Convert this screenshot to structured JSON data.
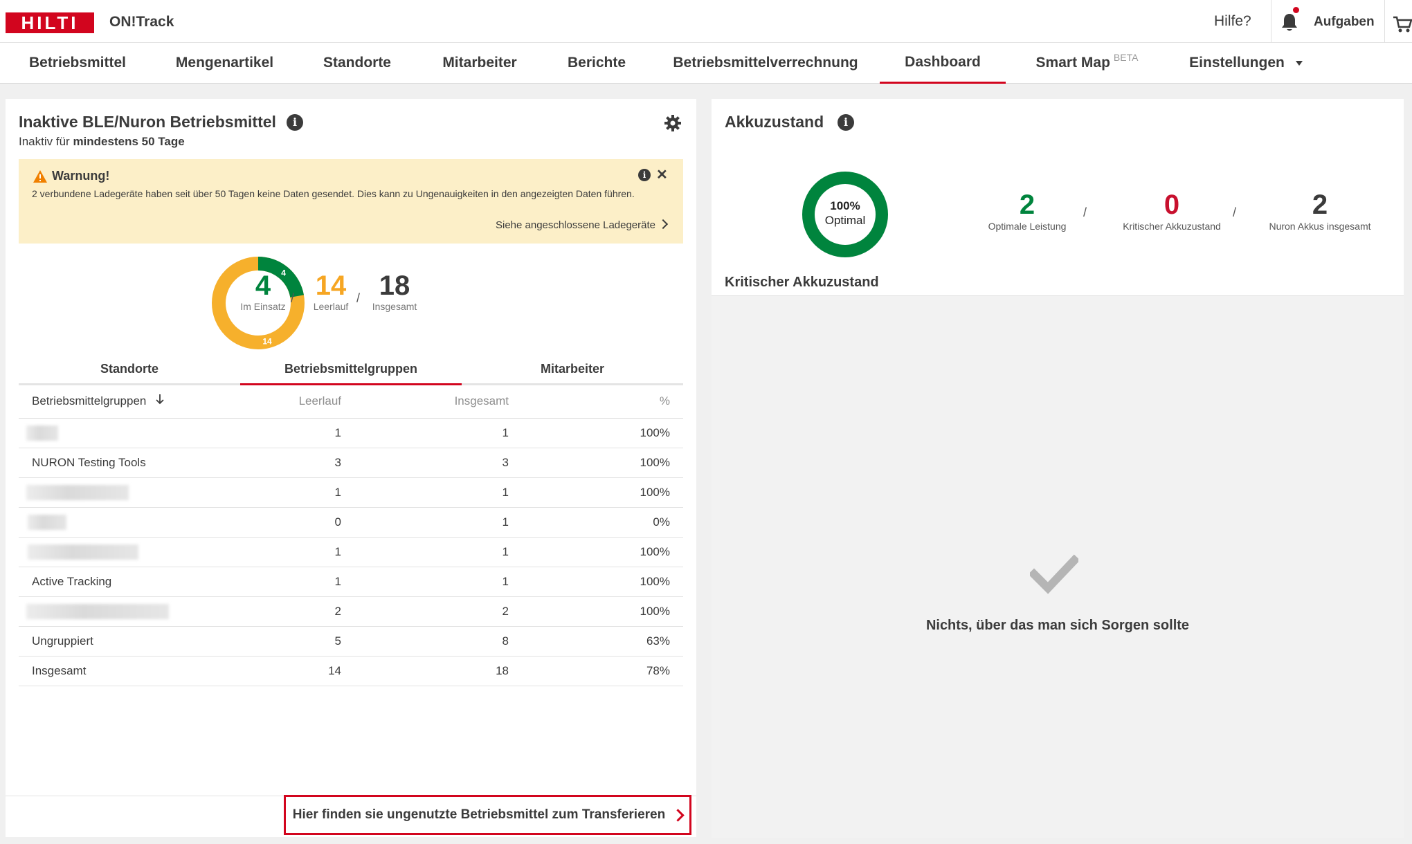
{
  "header": {
    "logo_text": "HILTI",
    "app_name": "ON!Track",
    "help_label": "Hilfe?",
    "tasks_label": "Aufgaben",
    "brand_color": "#d2051e"
  },
  "nav": {
    "items": [
      {
        "label": "Betriebsmittel"
      },
      {
        "label": "Mengenartikel"
      },
      {
        "label": "Standorte"
      },
      {
        "label": "Mitarbeiter"
      },
      {
        "label": "Berichte"
      },
      {
        "label": "Betriebsmittelverrechnung"
      },
      {
        "label": "Dashboard",
        "active": true
      },
      {
        "label": "Smart Map",
        "badge": "BETA"
      },
      {
        "label": "Einstellungen"
      }
    ]
  },
  "inactive_panel": {
    "title": "Inaktive BLE/Nuron Betriebsmittel",
    "subtitle_prefix": "Inaktiv für",
    "subtitle_bold": "mindestens 50 Tage",
    "warning": {
      "title": "Warnung!",
      "text": "2 verbundene Ladegeräte haben seit über 50 Tagen keine Daten gesendet. Dies kann zu Ungenauigkeiten in den angezeigten Daten führen.",
      "link": "Siehe angeschlossene Ladegeräte"
    },
    "donut": {
      "in_use": 4,
      "idle": 14,
      "in_use_label": "4",
      "idle_label": "14"
    },
    "stats": {
      "in_use": {
        "value": "4",
        "label": "Im Einsatz",
        "color": "#00843d"
      },
      "idle": {
        "value": "14",
        "label": "Leerlauf",
        "color": "#f6a623"
      },
      "total": {
        "value": "18",
        "label": "Insgesamt",
        "color": "#3b3b3b"
      },
      "separator": "/"
    },
    "tabs": [
      {
        "label": "Standorte"
      },
      {
        "label": "Betriebsmittelgruppen",
        "active": true
      },
      {
        "label": "Mitarbeiter"
      }
    ],
    "table": {
      "headers": [
        "Betriebsmittelgruppen",
        "Leerlauf",
        "Insgesamt",
        "%"
      ],
      "rows": [
        {
          "name": "",
          "idle": "1",
          "total": "1",
          "pct": "100%"
        },
        {
          "name": "NURON Testing Tools",
          "idle": "3",
          "total": "3",
          "pct": "100%"
        },
        {
          "name": "",
          "idle": "1",
          "total": "1",
          "pct": "100%"
        },
        {
          "name": "",
          "idle": "0",
          "total": "1",
          "pct": "0%"
        },
        {
          "name": "",
          "idle": "1",
          "total": "1",
          "pct": "100%"
        },
        {
          "name": "Active Tracking",
          "idle": "1",
          "total": "1",
          "pct": "100%"
        },
        {
          "name": "",
          "idle": "2",
          "total": "2",
          "pct": "100%"
        },
        {
          "name": "Ungruppiert",
          "idle": "5",
          "total": "8",
          "pct": "63%"
        },
        {
          "name": "Insgesamt",
          "idle": "14",
          "total": "18",
          "pct": "78%"
        }
      ]
    },
    "transfer_link": "Hier finden sie ungenutzte Betriebsmittel zum Transferieren"
  },
  "battery_panel": {
    "title": "Akkuzustand",
    "donut": {
      "percent": "100%",
      "label": "Optimal",
      "color": "#00843d"
    },
    "stats": [
      {
        "value": "2",
        "label": "Optimale Leistung",
        "color": "#00843d"
      },
      {
        "value": "0",
        "label": "Kritischer Akkuzustand",
        "color": "#c8102e"
      },
      {
        "value": "2",
        "label": "Nuron Akkus insgesamt",
        "color": "#3b3b3b"
      }
    ],
    "separator": "/",
    "critical_title": "Kritischer Akkuzustand",
    "empty_message": "Nichts, über das man sich Sorgen sollte"
  }
}
